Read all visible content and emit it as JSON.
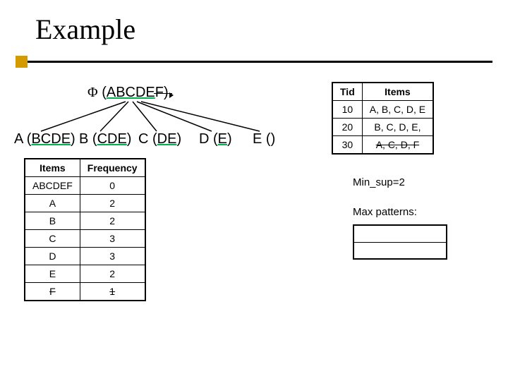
{
  "title": "Example",
  "root": {
    "phi": "Φ",
    "itemset": "ABCDEF"
  },
  "children": [
    {
      "prefix": "A",
      "remaining": "BCDE"
    },
    {
      "prefix": "B",
      "remaining": "CDE"
    },
    {
      "prefix": "C",
      "remaining": "DE"
    },
    {
      "prefix": "D",
      "remaining": "E"
    },
    {
      "prefix": "E",
      "remaining": ""
    }
  ],
  "tid_table": {
    "headers": [
      "Tid",
      "Items"
    ],
    "rows": [
      {
        "tid": "10",
        "items": "A, B, C, D, E",
        "struck": false
      },
      {
        "tid": "20",
        "items": "B, C, D, E,",
        "struck": false
      },
      {
        "tid": "30",
        "items": "A, C, D, F",
        "struck": true
      }
    ]
  },
  "freq_table": {
    "headers": [
      "Items",
      "Frequency"
    ],
    "rows": [
      {
        "item": "ABCDEF",
        "freq": "0",
        "struck": false
      },
      {
        "item": "A",
        "freq": "2",
        "struck": false
      },
      {
        "item": "B",
        "freq": "2",
        "struck": false
      },
      {
        "item": "C",
        "freq": "3",
        "struck": false
      },
      {
        "item": "D",
        "freq": "3",
        "struck": false
      },
      {
        "item": "E",
        "freq": "2",
        "struck": false
      },
      {
        "item": "F",
        "freq": "1",
        "struck": true
      }
    ]
  },
  "info": {
    "minsup": "Min_sup=2",
    "maxpat": "Max patterns:"
  }
}
